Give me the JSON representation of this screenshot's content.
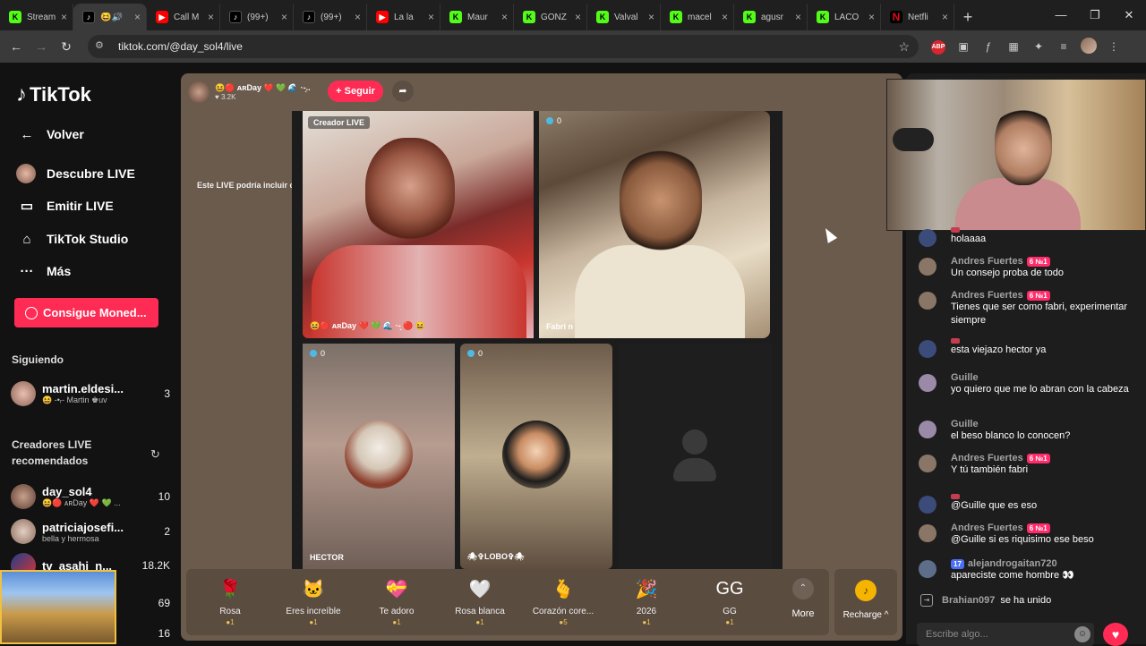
{
  "browser": {
    "tabs": [
      {
        "label": "Stream",
        "fav": "kick",
        "icon": "K"
      },
      {
        "label": "😆🔊",
        "fav": "tk",
        "icon": "♪",
        "active": true
      },
      {
        "label": "Call M",
        "fav": "yt",
        "icon": "▶"
      },
      {
        "label": "(99+)",
        "fav": "tk",
        "icon": "♪"
      },
      {
        "label": "(99+)",
        "fav": "tk",
        "icon": "♪"
      },
      {
        "label": "La la",
        "fav": "yt",
        "icon": "▶"
      },
      {
        "label": "Maur",
        "fav": "kick",
        "icon": "K"
      },
      {
        "label": "GONZ",
        "fav": "kick",
        "icon": "K"
      },
      {
        "label": "Valval",
        "fav": "kick",
        "icon": "K"
      },
      {
        "label": "macel",
        "fav": "kick",
        "icon": "K"
      },
      {
        "label": "agusr",
        "fav": "kick",
        "icon": "K"
      },
      {
        "label": "LACO",
        "fav": "kick",
        "icon": "K"
      },
      {
        "label": "Netfli",
        "fav": "nf",
        "icon": "N"
      }
    ],
    "url": "tiktok.com/@day_sol4/live",
    "new_tab": "+",
    "minimize": "—",
    "restore": "❐",
    "close": "✕"
  },
  "sidebar": {
    "logo": "TikTok",
    "nav": [
      {
        "label": "Volver",
        "icon": "←"
      },
      {
        "label": "Descubre LIVE",
        "icon": "avatar"
      },
      {
        "label": "Emitir LIVE",
        "icon": "▭"
      },
      {
        "label": "TikTok Studio",
        "icon": "⌂"
      },
      {
        "label": "Más",
        "icon": "···"
      }
    ],
    "coins_button": "Consigue Moned...",
    "following_title": "Siguiendo",
    "following": [
      {
        "name": "martin.eldesi...",
        "sub": "😆 -•ᵣ- Martin ♚uv",
        "count": "3"
      }
    ],
    "recommended_title": "Creadores LIVE recomendados",
    "recommended": [
      {
        "name": "day_sol4",
        "sub": "😆🔴 ᴀʀDay ❤️ 💚 ...",
        "count": "10"
      },
      {
        "name": "patriciajosefi...",
        "sub": "bella y hermosa",
        "count": "2"
      },
      {
        "name": "tv_asahi_n...",
        "sub": "",
        "count": "18.2K"
      },
      {
        "name": "",
        "sub": "",
        "count": "69"
      },
      {
        "name": "",
        "sub": "",
        "count": "16"
      }
    ]
  },
  "stream": {
    "host_name": "😆🔴 ᴀʀDay ❤️ 💚 🌊 ·-͙..",
    "host_viewers": "♥ 3.2K",
    "follow_label": "+ Seguir",
    "ai_notice": "Este LIVE podría incluir contenido generado por IA",
    "cells": {
      "creator_tag": "Creador LIVE",
      "creator_name": "😆🔴 ᴀʀDay ❤️ 💚 🌊 ·-͙ 🔴 😆",
      "fabri_count": "0",
      "fabri_name": "Fabri n",
      "hector_count": "0",
      "hector_name": "HECTOR",
      "lobo_count": "0",
      "lobo_name": "🕷✞LOBO✞🕷"
    },
    "gifts": [
      {
        "name": "Rosa",
        "price": "●1",
        "icon": "🌹"
      },
      {
        "name": "Eres increíble",
        "price": "●1",
        "icon": "🐱"
      },
      {
        "name": "Te adoro",
        "price": "●1",
        "icon": "💝"
      },
      {
        "name": "Rosa blanca",
        "price": "●1",
        "icon": "🤍"
      },
      {
        "name": "Corazón core...",
        "price": "●5",
        "icon": "🫰"
      },
      {
        "name": "2026",
        "price": "●1",
        "icon": "🎉"
      },
      {
        "name": "GG",
        "price": "●1",
        "icon": "GG"
      }
    ],
    "more_label": "More",
    "recharge_label": "Recharge ^"
  },
  "chat": {
    "messages": [
      {
        "user": "",
        "text": "holaaaa",
        "badge": "",
        "flag": true
      },
      {
        "user": "Andres Fuertes",
        "text": "Un consejo proba de todo",
        "badge": "6 №1"
      },
      {
        "user": "Andres Fuertes",
        "text": "Tienes que ser como fabri, experimentar siempre",
        "badge": "6 №1"
      },
      {
        "user": "",
        "text": "esta viejazo hector ya",
        "badge": "",
        "flag": true
      },
      {
        "user": "Guille",
        "text": "yo quiero que me lo abran con la cabeza",
        "badge": ""
      },
      {
        "user": "Guille",
        "text": "el beso blanco lo conocen?",
        "badge": ""
      },
      {
        "user": "Andres Fuertes",
        "text": "Y tú también fabri",
        "badge": "6 №1"
      },
      {
        "user": "",
        "text": "@Guille que es eso",
        "badge": "",
        "flag": true
      },
      {
        "user": "Andres Fuertes",
        "text": "@Guille si es riquisimo ese beso",
        "badge": "6 №1"
      },
      {
        "user": "alejandrogaitan720",
        "text": "apareciste come hombre 👀",
        "badge": "17",
        "blue": true
      }
    ],
    "joined_user": "Brahian097",
    "joined_text": "se ha unido",
    "input_placeholder": "Escribe algo..."
  }
}
